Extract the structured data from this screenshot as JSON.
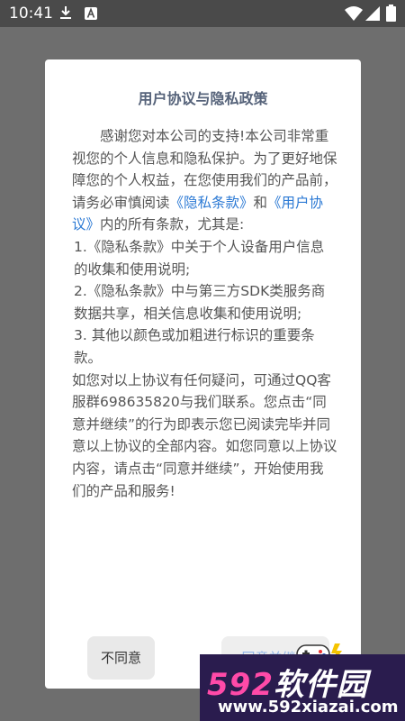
{
  "status_bar": {
    "time": "10:41",
    "icons": [
      "download-icon",
      "a-badge-icon",
      "wifi-icon",
      "signal-icon",
      "battery-icon"
    ]
  },
  "dialog": {
    "title": "用户协议与隐私政策",
    "intro_a": "感谢您对本公司的支持!本公司非常重视您的个人信息和隐私保护。为了更好地保障您的个人权益，在您使用我们的产品前，请务必审慎阅读",
    "privacy_link": "《隐私条款》",
    "and": "和",
    "user_agreement_link": "《用户协议》",
    "intro_b": "内的所有条款，尤其是:",
    "item1": "1.《隐私条款》中关于个人设备用户信息的收集和使用说明;",
    "item2": "2.《隐私条款》中与第三方SDK类服务商数据共享，相关信息收集和使用说明;",
    "item3": "3. 其他以颜色或加粗进行标识的重要条款。",
    "outro": "如您对以上协议有任何疑问，可通过QQ客服群698635820与我们联系。您点击“同意并继续”的行为即表示您已阅读完毕并同意以上协议的全部内容。如您同意以上协议内容，请点击“同意并继续”，开始使用我们的产品和服务!",
    "disagree_label": "不同意",
    "agree_label": "同意并继续"
  },
  "watermark": {
    "logo_num": "592",
    "logo_text": "软件园",
    "url": "www.592xiazai.com"
  },
  "colors": {
    "link": "#2b79d4",
    "title": "#56637a",
    "watermark_bg": "#2a1c4e",
    "watermark_accent": "#ff4aa8"
  }
}
